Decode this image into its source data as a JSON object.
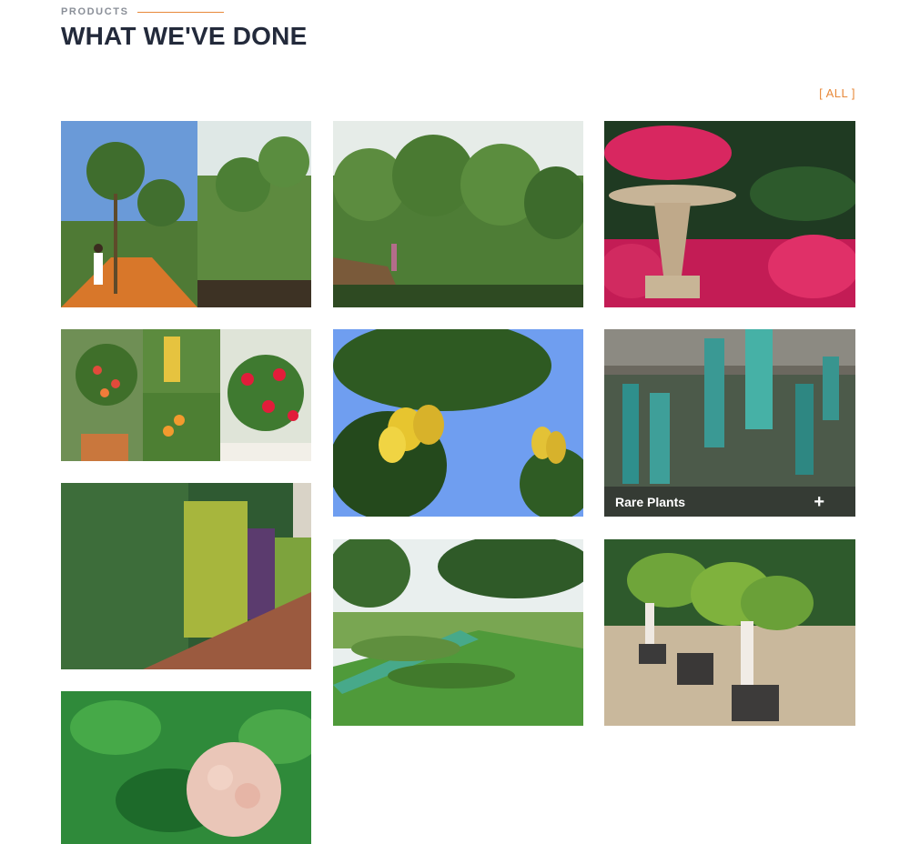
{
  "header": {
    "eyebrow": "PRODUCTS",
    "title": "WHAT WE'VE DONE"
  },
  "filter": {
    "label": "[ ALL ]"
  },
  "colors": {
    "accent": "#e8893a",
    "heading": "#232a3b",
    "muted": "#8a8f98"
  },
  "gallery": {
    "items": [
      {
        "id": "nursery-saplings"
      },
      {
        "id": "nursery-trees"
      },
      {
        "id": "flower-fountain"
      },
      {
        "id": "fruit-plants-collage"
      },
      {
        "id": "star-fruit-tree"
      },
      {
        "id": "rare-plants",
        "label": "Rare Plants"
      },
      {
        "id": "vertical-garden"
      },
      {
        "id": "landscape-lawn"
      },
      {
        "id": "bonsai-ficus"
      },
      {
        "id": "ixora-flower"
      }
    ]
  }
}
